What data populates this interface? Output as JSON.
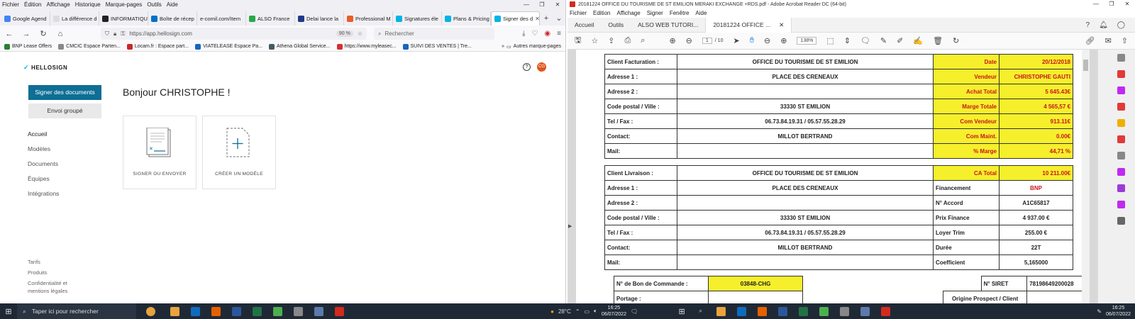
{
  "firefox": {
    "menu": [
      "Fichier",
      "Édition",
      "Affichage",
      "Historique",
      "Marque-pages",
      "Outils",
      "Aide"
    ],
    "tabs": [
      {
        "label": "Google Agend",
        "color": "#4285f4"
      },
      {
        "label": "La différence d",
        "color": "#888888"
      },
      {
        "label": "INFORMATIQU",
        "color": "#222222"
      },
      {
        "label": "Boîte de récep",
        "color": "#0072c6"
      },
      {
        "label": "e-comil.com/Item",
        "color": "#cccccc"
      },
      {
        "label": "ALSO France",
        "color": "#2aa84a"
      },
      {
        "label": "Delai lance la",
        "color": "#1e3a8a"
      },
      {
        "label": "Professional M",
        "color": "#e85d2a"
      },
      {
        "label": "Signatures éle",
        "color": "#00b3e6"
      },
      {
        "label": "Plans & Pricing",
        "color": "#00b3e6"
      },
      {
        "label": "Signer des d",
        "color": "#00b3e6"
      }
    ],
    "url": "https://app.hellosign.com",
    "zoom": "90 %",
    "search_placeholder": "Rechercher",
    "bookmarks": [
      {
        "label": "BNP Lease Offers",
        "color": "#2e7d32"
      },
      {
        "label": "CMCIC Espace Parten...",
        "color": "#888888"
      },
      {
        "label": "Locam.fr : Espace part...",
        "color": "#c62828"
      },
      {
        "label": "VIATELEASE Espace Pa...",
        "color": "#1565c0"
      },
      {
        "label": "Athena Global Service...",
        "color": "#455a64"
      },
      {
        "label": "https://www.myleasec...",
        "color": "#d32f2f"
      },
      {
        "label": "SUIVI DES VENTES | Tre...",
        "color": "#1565c0"
      }
    ],
    "bookmarks_other": "Autres marque-pages"
  },
  "hellosign": {
    "logo": "HELLOSIGN",
    "avatar": "CG",
    "btn_sign": "Signer des documents",
    "btn_group": "Envoi groupé",
    "nav": [
      "Accueil",
      "Modèles",
      "Documents",
      "Équipes",
      "Intégrations"
    ],
    "footer": [
      "Tarifs",
      "Produits",
      "Confidentialité et",
      "mentions légales"
    ],
    "greeting": "Bonjour CHRISTOPHE !",
    "card_sign": "SIGNER OU ENVOYER",
    "card_template": "CRÉER UN MODÈLE"
  },
  "acrobat": {
    "title": "20181224 OFFICE DU TOURISME DE ST EMILION MERAKI EXCHANGE +RDS.pdf - Adobe Acrobat Reader DC (64-bit)",
    "menu": [
      "Fichier",
      "Edition",
      "Affichage",
      "Signer",
      "Fenêtre",
      "Aide"
    ],
    "tabs": [
      "Accueil",
      "Outils",
      "ALSO WEB TUTORI...",
      "20181224 OFFICE ..."
    ],
    "page_current": "1",
    "page_total": "/ 10",
    "zoom": "138%",
    "facturation": [
      {
        "k": "Client Facturation :",
        "v": "OFFICE DU TOURISME DE ST EMILION",
        "rk": "Date",
        "rv": "20/12/2018"
      },
      {
        "k": "Adresse 1 :",
        "v": "PLACE DES CRENEAUX",
        "rk": "Vendeur",
        "rv": "CHRISTOPHE GAUTI"
      },
      {
        "k": "Adresse 2 :",
        "v": "",
        "rk": "Achat Total",
        "rv": "5 645.43€"
      },
      {
        "k": "Code postal / Ville :",
        "v": "33330 ST EMILION",
        "rk": "Marge Totale",
        "rv": "4 565,57 €"
      },
      {
        "k": "Tel / Fax :",
        "v": "06.73.84.19.31 / 05.57.55.28.29",
        "rk": "Com Vendeur",
        "rv": "913.11€"
      },
      {
        "k": "Contact:",
        "v": "MILLOT BERTRAND",
        "rk": "Com Maint.",
        "rv": "0.00€"
      },
      {
        "k": "Mail:",
        "v": "",
        "rk": "% Marge",
        "rv": "44,71 %"
      }
    ],
    "livraison": [
      {
        "k": "Client Livraison :",
        "v": "OFFICE DU TOURISME DE ST EMILION",
        "rk": "CA Total",
        "rv": "10 211.00€",
        "yellow": true
      },
      {
        "k": "Adresse 1 :",
        "v": "PLACE DES CRENEAUX",
        "rk": "Financement",
        "rv": "BNP",
        "red": true
      },
      {
        "k": "Adresse 2 :",
        "v": "",
        "rk": "N° Accord",
        "rv": "A1C65817"
      },
      {
        "k": "Code postal / Ville :",
        "v": "33330 ST EMILION",
        "rk": "Prix Finance",
        "rv": "4 937.00 €"
      },
      {
        "k": "Tel / Fax :",
        "v": "06.73.84.19.31 / 05.57.55.28.29",
        "rk": "Loyer Trim",
        "rv": "255.00 €"
      },
      {
        "k": "Contact:",
        "v": "MILLOT BERTRAND",
        "rk": "Durée",
        "rv": "22T"
      },
      {
        "k": "Mail:",
        "v": "",
        "rk": "Coefficient",
        "rv": "5,165000"
      }
    ],
    "bon_label": "N° de Bon de Commande :",
    "bon_value": "03848-CHG",
    "portage_label": "Portage :",
    "siret_label": "N° SIRET",
    "siret_value": "78198649200028",
    "origine_label": "Origine Prospect / Client"
  },
  "taskbar": {
    "search_placeholder": "Taper ici pour rechercher",
    "temp": "28°C",
    "time": "16:25",
    "date": "06/07/2022",
    "apps": [
      "#e8a33d",
      "#0f6cbd",
      "#e66000",
      "#2b579a",
      "#217346",
      "#4caf50",
      "#888888",
      "#5c7aaa",
      "#d42a1e"
    ],
    "apps_right": [
      "#e8a33d",
      "#0f6cbd",
      "#e66000",
      "#2b579a",
      "#217346",
      "#4caf50",
      "#888888",
      "#5c7aaa",
      "#d42a1e"
    ]
  }
}
